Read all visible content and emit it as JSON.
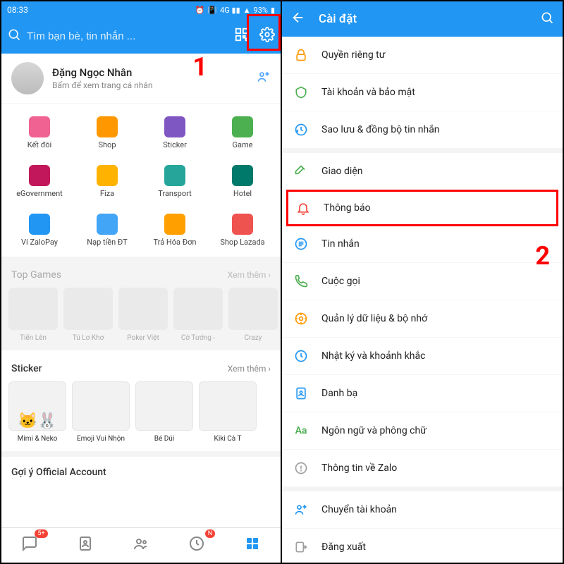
{
  "statusbar": {
    "time": "08:33",
    "battery": "93%"
  },
  "search": {
    "placeholder": "Tìm bạn bè, tin nhắn ..."
  },
  "steps": {
    "one": "1",
    "two": "2"
  },
  "profile": {
    "name": "Đặng Ngọc Nhân",
    "sub": "Bấm để xem trang cá nhân"
  },
  "apps": [
    {
      "label": "Kết đôi",
      "cls": "pink"
    },
    {
      "label": "Shop",
      "cls": "orange"
    },
    {
      "label": "Sticker",
      "cls": "purple"
    },
    {
      "label": "Game",
      "cls": "green"
    },
    {
      "label": "eGovernment",
      "cls": "dpurple"
    },
    {
      "label": "Fiza",
      "cls": "yellow"
    },
    {
      "label": "Transport",
      "cls": "teal"
    },
    {
      "label": "Hotel",
      "cls": "teal2"
    },
    {
      "label": "Ví ZaloPay",
      "cls": "blue"
    },
    {
      "label": "Nạp tiền ĐT",
      "cls": "lblue"
    },
    {
      "label": "Trả Hóa Đơn",
      "cls": "amber"
    },
    {
      "label": "Shop Lazada",
      "cls": "red"
    }
  ],
  "topgames": {
    "title": "Top Games",
    "more": "Xem thêm  ›",
    "items": [
      "Tiến Lên",
      "Tú Lơ Khơ",
      "Poker Việt",
      "Cờ Tướng -",
      "Crazy"
    ]
  },
  "sticker": {
    "title": "Sticker",
    "more": "Xem thêm  ›",
    "items": [
      "Mimi & Neko",
      "Emoji Vui Nhộn",
      "Bé Dúi",
      "Kiki Cà T"
    ]
  },
  "oa": {
    "title": "Gợi ý Official Account"
  },
  "nav": {
    "badge1": "5+",
    "badge3": "N"
  },
  "settings": {
    "title": "Cài đặt",
    "items": [
      {
        "label": "Quyền riêng tư"
      },
      {
        "label": "Tài khoản và bảo mật"
      },
      {
        "label": "Sao lưu & đồng bộ tin nhắn"
      },
      {
        "label": "Giao diện"
      },
      {
        "label": "Thông báo"
      },
      {
        "label": "Tin nhắn"
      },
      {
        "label": "Cuộc gọi"
      },
      {
        "label": "Quản lý dữ liệu & bộ nhớ"
      },
      {
        "label": "Nhật ký và khoảnh khắc"
      },
      {
        "label": "Danh bạ"
      },
      {
        "label": "Ngôn ngữ và phông chữ"
      },
      {
        "label": "Thông tin về Zalo"
      },
      {
        "label": "Chuyển tài khoản"
      },
      {
        "label": "Đăng xuất"
      }
    ]
  }
}
